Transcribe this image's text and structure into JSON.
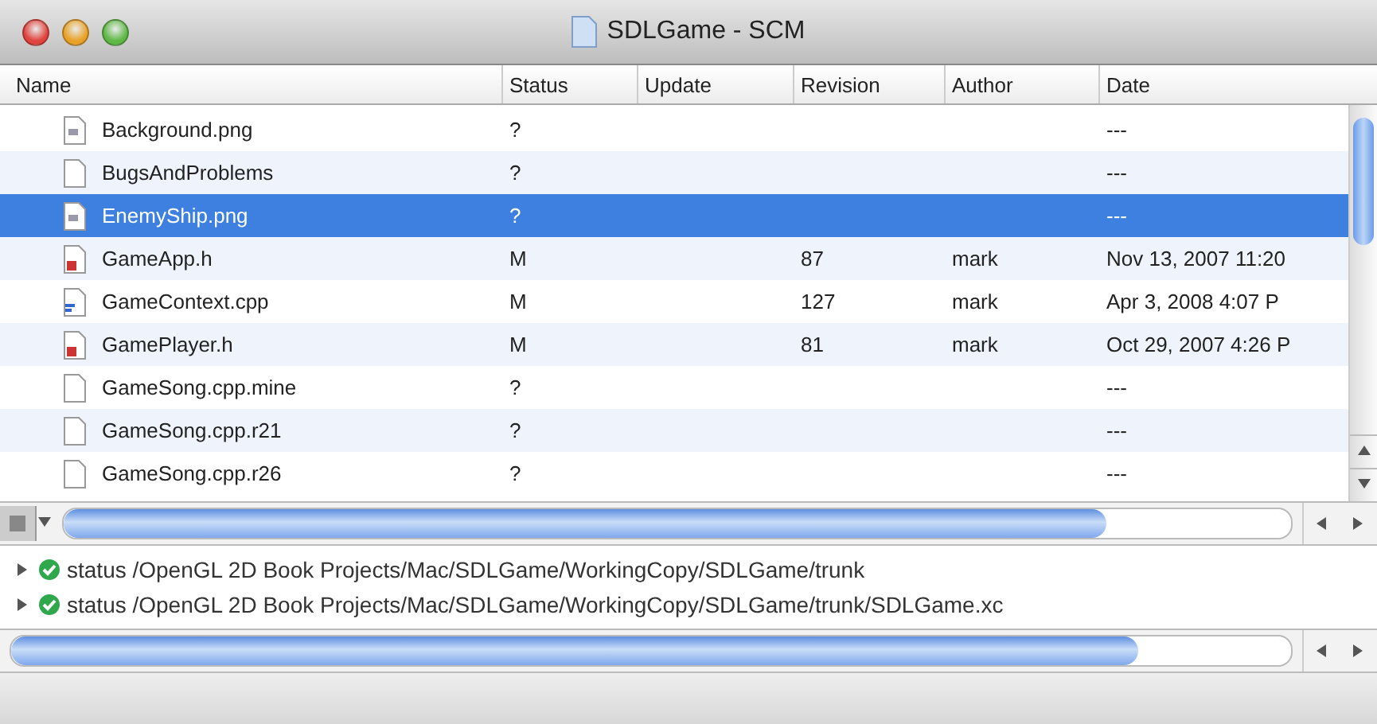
{
  "window": {
    "title": "SDLGame - SCM"
  },
  "table": {
    "columns": [
      "Name",
      "Status",
      "Update",
      "Revision",
      "Author",
      "Date"
    ],
    "rows": [
      {
        "kind": "image",
        "name": "Background.png",
        "status": "?",
        "update": "",
        "revision": "",
        "author": "",
        "date": "---",
        "selected": false
      },
      {
        "kind": "plain",
        "name": "BugsAndProblems",
        "status": "?",
        "update": "",
        "revision": "",
        "author": "",
        "date": "---",
        "selected": false
      },
      {
        "kind": "image",
        "name": "EnemyShip.png",
        "status": "?",
        "update": "",
        "revision": "",
        "author": "",
        "date": "---",
        "selected": true
      },
      {
        "kind": "header",
        "name": "GameApp.h",
        "status": "M",
        "update": "",
        "revision": "87",
        "author": "mark",
        "date": "Nov 13, 2007 11:20",
        "selected": false
      },
      {
        "kind": "source",
        "name": "GameContext.cpp",
        "status": "M",
        "update": "",
        "revision": "127",
        "author": "mark",
        "date": "Apr 3, 2008 4:07 P",
        "selected": false
      },
      {
        "kind": "header",
        "name": "GamePlayer.h",
        "status": "M",
        "update": "",
        "revision": "81",
        "author": "mark",
        "date": "Oct 29, 2007 4:26 P",
        "selected": false
      },
      {
        "kind": "plain",
        "name": "GameSong.cpp.mine",
        "status": "?",
        "update": "",
        "revision": "",
        "author": "",
        "date": "---",
        "selected": false
      },
      {
        "kind": "plain",
        "name": "GameSong.cpp.r21",
        "status": "?",
        "update": "",
        "revision": "",
        "author": "",
        "date": "---",
        "selected": false
      },
      {
        "kind": "plain",
        "name": "GameSong.cpp.r26",
        "status": "?",
        "update": "",
        "revision": "",
        "author": "",
        "date": "---",
        "selected": false
      }
    ]
  },
  "log": [
    {
      "text": "status /OpenGL 2D Book Projects/Mac/SDLGame/WorkingCopy/SDLGame/trunk",
      "ok": true
    },
    {
      "text": "status /OpenGL 2D Book Projects/Mac/SDLGame/WorkingCopy/SDLGame/trunk/SDLGame.xc",
      "ok": true
    }
  ]
}
